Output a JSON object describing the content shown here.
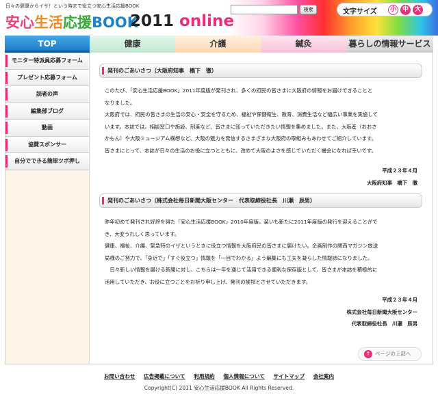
{
  "header": {
    "tagline": "日々の健康からイザ！という時まで役立つ安心生活応援BOOK",
    "logo_jp": [
      "安心",
      "生活",
      "応援",
      "BOOK"
    ],
    "logo_year": "2011",
    "logo_online": "online",
    "search_placeholder": "",
    "search_button": "検索",
    "font_size_label": "文字サイズ",
    "font_small": "小",
    "font_mid": "中",
    "font_large": "大"
  },
  "gnav": {
    "top": "TOP",
    "health": "健康",
    "care": "介護",
    "acupuncture": "鍼灸",
    "living": "暮らしの情報サービス"
  },
  "sidebar": {
    "items": [
      {
        "label": "モニター特派員応募フォーム"
      },
      {
        "label": "プレゼント応募フォーム"
      },
      {
        "label": "読者の声"
      },
      {
        "label": "編集部ブログ"
      },
      {
        "label": "動画"
      },
      {
        "label": "協賛スポンサー"
      },
      {
        "label": "自分でできる簡単ツボ押し"
      }
    ]
  },
  "main": {
    "section1": {
      "title": "発刊のごあいさつ（大阪府知事　橋下　徹）",
      "lines": [
        "このたび、「安心生活応援BOOK」2011年度版が発刊され、多くの府民の皆さまに大阪府の情報をお届けできることと",
        "なりました。",
        "大阪府では、府民の皆さまの生活の安心・安全を守るため、福祉や保健衛生、教育、消費生活など幅広い事業を実施して",
        "います。本誌では、相談窓口や施設、制度など、皆さまに知っていただきたい情報を集めました。また、大阪産（おおさ",
        "かもん）や大阪ミュージアム構想など、大阪の魅力を発信するさまざまな大阪府の取組みもあわせてご紹介しています。",
        "皆さまにとって、本誌が日々の生活のお役に立つとともに、改めて大阪のよさを感じていただく機会になれば幸いです。"
      ],
      "sign_date": "平成２３年４月",
      "sign_name": "大阪府知事　橋下　徹"
    },
    "section2": {
      "title": "発刊のごあいさつ（株式会社毎日新聞大阪センター　代表取締役社長　川瀬　辰男）",
      "lines": [
        "昨年初めて発刊され好評を得た「安心生活応援BOOK」2010年度版。装いも新たに2011年度版の発行を迎えることがで",
        "き、大変うれしく思っています。",
        "健康、福祉、介護、緊急時のイザというときに役立つ情報を大阪府民の皆さまに届けたい。企画制作の関西マガジン放送",
        "局様のご努力で、「身近で」「すぐ役立つ」情報を「一目でわかる」よう編集にも工夫を凝らした情報誌になりました。",
        "　日々新しい情報を届ける新聞に対し、こちらは一年を通じて活用できる便利な保存版として、皆さまが本誌を積極的に",
        "活用していただき、お役に立つことをお祈り申し上げ、発刊の挨拶とさせていただきます。"
      ],
      "sign_date": "平成２３年４月",
      "sign_company": "株式会社毎日新聞大阪センター",
      "sign_name": "代表取締役社長　川瀬　辰男"
    },
    "page_top": "ページの上部へ"
  },
  "footer": {
    "links": [
      "お問い合わせ",
      "広告掲載について",
      "利用規約",
      "個人情報について",
      "サイトマップ",
      "会社案内"
    ],
    "copyright": "Copyright(C) 2011 安心生活応援BOOK All Rights Reserved."
  }
}
